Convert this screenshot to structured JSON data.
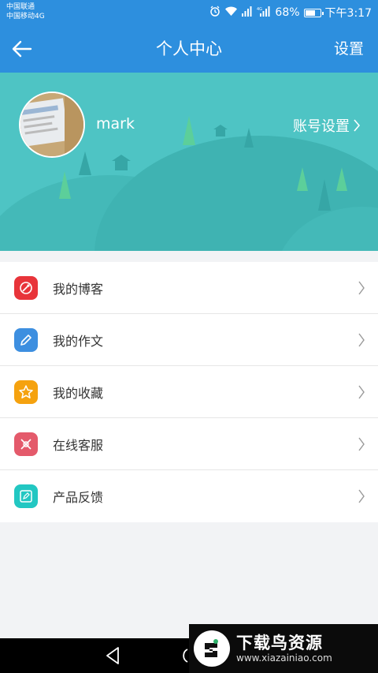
{
  "status_bar": {
    "carrier_1": "中国联通",
    "carrier_2": "中国移动4G",
    "battery": "68%",
    "time": "下午3:17",
    "icons": [
      "alarm-icon",
      "wifi-icon",
      "signal-icon",
      "signal-4g-icon",
      "battery-icon"
    ],
    "battery_level": 0.68
  },
  "header": {
    "title": "个人中心",
    "settings_label": "设置",
    "back_icon": "back-arrow-icon"
  },
  "profile": {
    "username": "mark",
    "account_settings_label": "账号设置"
  },
  "menu": {
    "items": [
      {
        "label": "我的博客",
        "icon": "blog-icon",
        "color": "#e8343a"
      },
      {
        "label": "我的作文",
        "icon": "pencil-icon",
        "color": "#3d8fe0"
      },
      {
        "label": "我的收藏",
        "icon": "star-icon",
        "color": "#f5a20f"
      },
      {
        "label": "在线客服",
        "icon": "service-icon",
        "color": "#e45a6b"
      },
      {
        "label": "产品反馈",
        "icon": "feedback-icon",
        "color": "#22c7c2"
      }
    ]
  },
  "watermark": {
    "title": "下载鸟资源",
    "url": "www.xiazainiao.com"
  },
  "colors": {
    "primary": "#2d8fde",
    "banner": "#4ec4c4"
  }
}
